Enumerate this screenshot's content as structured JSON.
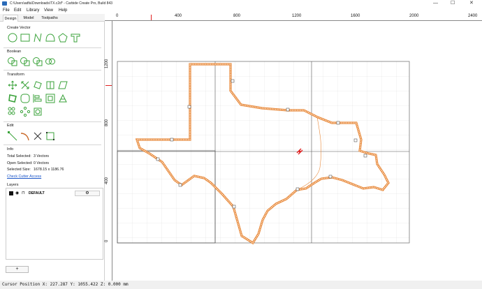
{
  "window": {
    "title": "C:\\Users\\adfa\\Downloads\\TX.c2d* - Carbide Create Pro, Build 843",
    "minimize": "—",
    "maximize": "☐",
    "close": "✕"
  },
  "menu": [
    "File",
    "Edit",
    "Library",
    "View",
    "Help"
  ],
  "tabs": [
    "Design",
    "Model",
    "Toolpaths"
  ],
  "sections": {
    "create_vector": "Create Vector",
    "boolean": "Boolean",
    "transform": "Transform",
    "edit": "Edit",
    "info": "Info",
    "layers": "Layers"
  },
  "info": {
    "total_selected_label": "Total Selected:",
    "total_selected_value": "3 Vectors",
    "open_selected_label": "Open Selected:",
    "open_selected_value": "0 Vectors",
    "selected_size_label": "Selected Size:",
    "selected_size_value": "1678.15 x 1186.76",
    "check_cutter_link": "Check Cutter Access"
  },
  "layers": {
    "default_name": "DEFAULT",
    "settings_icon": "gear-icon",
    "add_label": "+"
  },
  "ruler": {
    "h_ticks": [
      "0",
      "400",
      "800",
      "1200",
      "1600",
      "2000",
      "2400"
    ],
    "v_ticks": [
      "1200",
      "800",
      "400",
      "0"
    ]
  },
  "status": "Cursor Position X: 227.287 Y: 1055.422 Z: 0.000 mm",
  "colors": {
    "accent_green": "#3aa23a",
    "shape_orange": "#e8893a",
    "marker_red": "#e02020",
    "link_blue": "#1a55c8"
  }
}
